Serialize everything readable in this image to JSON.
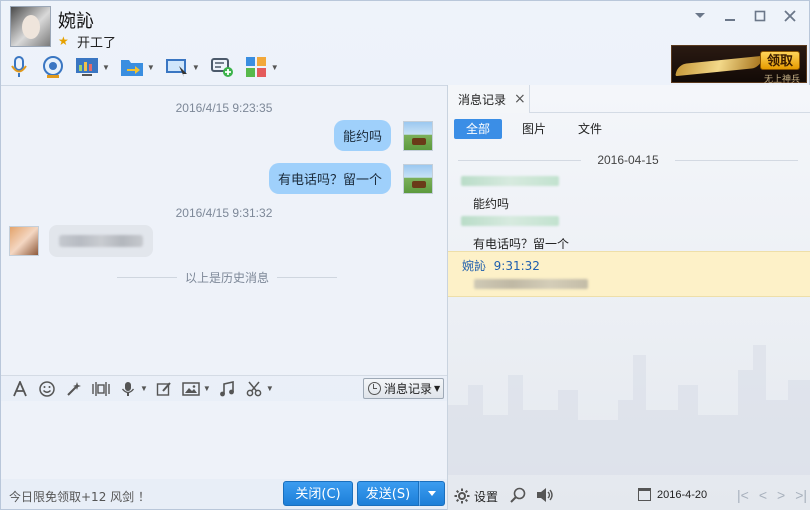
{
  "window": {
    "contact_name": "婉訫",
    "status": "开工了",
    "controls": [
      "chevron-down-icon",
      "minimize-icon",
      "maximize-icon",
      "close-icon"
    ]
  },
  "toolbar": {
    "items": [
      "microphone-icon",
      "video-camera-icon",
      "remote-screen-icon",
      "file-transfer-icon",
      "screen-share-icon",
      "add-app-icon",
      "apps-grid-icon"
    ]
  },
  "promo": {
    "button": "领取",
    "subtitle": "无上神兵"
  },
  "chat": {
    "messages": [
      {
        "time": "2016/4/15 9:23:35",
        "direction": "out",
        "text": "能约吗"
      },
      {
        "direction": "out",
        "text": "有电话吗？留一个"
      },
      {
        "time": "2016/4/15 9:31:32",
        "direction": "in",
        "text": ""
      }
    ],
    "history_divider": "以上是历史消息"
  },
  "input_toolbar": {
    "history_button": "消息记录"
  },
  "footer": {
    "promo_text": "今日限免领取+12 风剑 ！",
    "close_button": "关闭(C)",
    "send_button": "发送(S)"
  },
  "history_panel": {
    "tab_label": "消息记录",
    "filters": [
      "全部",
      "图片",
      "文件"
    ],
    "active_filter": "全部",
    "date": "2016-04-15",
    "records": [
      {
        "text": "能约吗"
      },
      {
        "text": "有电话吗？留一个"
      }
    ],
    "highlight": {
      "sender": "婉訫",
      "time": "9:31:32"
    },
    "footer": {
      "settings": "设置",
      "date": "2016-4-20"
    }
  }
}
